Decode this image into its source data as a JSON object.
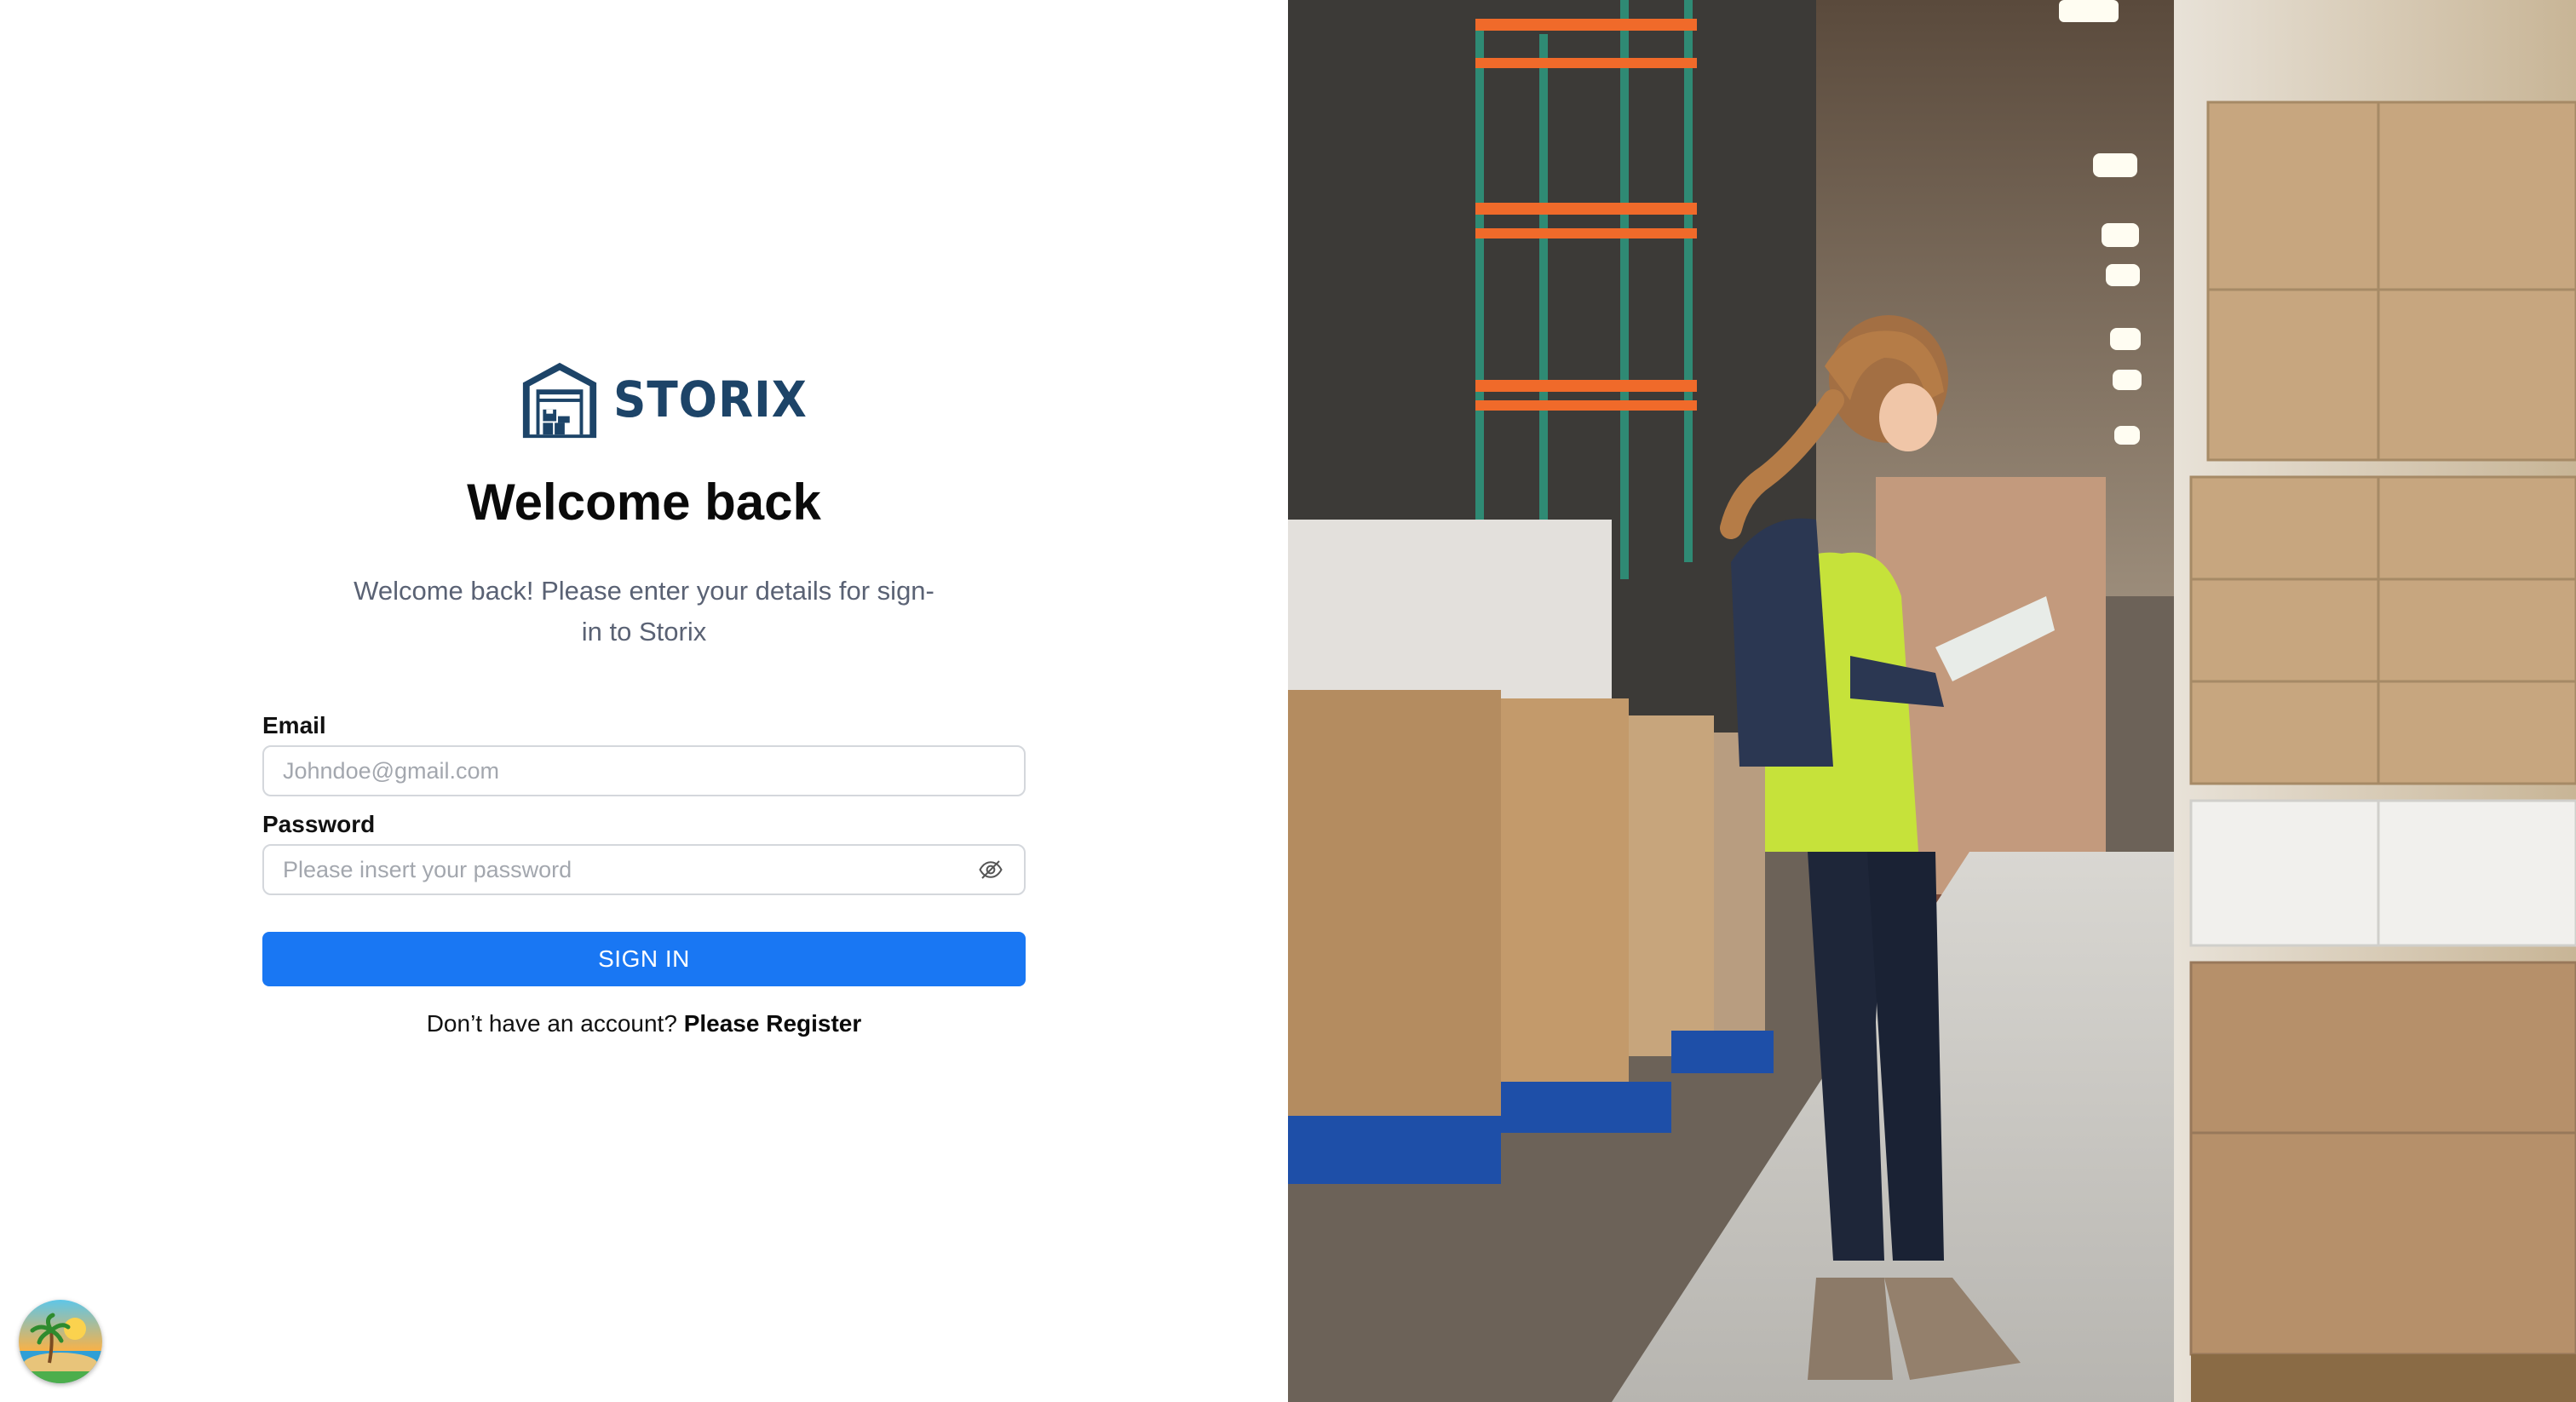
{
  "brand": {
    "name": "STORIX",
    "color": "#1d4468"
  },
  "heading": {
    "title": "Welcome back",
    "subtitle": "Welcome back! Please enter your details for sign-in to Storix"
  },
  "form": {
    "email": {
      "label": "Email",
      "placeholder": "Johndoe@gmail.com",
      "value": ""
    },
    "password": {
      "label": "Password",
      "placeholder": "Please insert your password",
      "value": "",
      "toggle_icon": "eye-slash-icon"
    },
    "submit_label": "SIGN IN",
    "submit_color": "#1977f3"
  },
  "register": {
    "prompt": "Don’t have an account?",
    "link": "Please Register"
  },
  "hero": {
    "description_icon": "warehouse-worker-photo"
  },
  "corner_badge": {
    "icon": "beach-island-icon"
  }
}
